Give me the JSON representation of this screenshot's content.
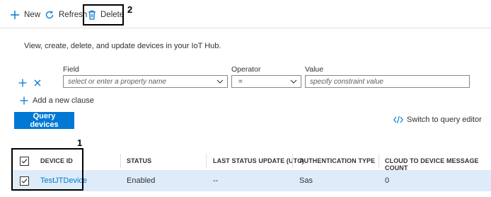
{
  "toolbar": {
    "new_label": "New",
    "refresh_label": "Refresh",
    "delete_label": "Delete",
    "annotation_delete": "2"
  },
  "description": "View, create, delete, and update devices in your IoT Hub.",
  "filter": {
    "field_label": "Field",
    "field_placeholder": "select or enter a property name",
    "operator_label": "Operator",
    "operator_value": "=",
    "value_label": "Value",
    "value_placeholder": "specify constraint value",
    "add_clause_label": "Add a new clause"
  },
  "query_button_label": "Query devices",
  "switch_editor_label": "Switch to query editor",
  "table": {
    "annotation_table": "1",
    "columns": [
      "DEVICE ID",
      "STATUS",
      "LAST STATUS UPDATE (UTC)",
      "AUTHENTICATION TYPE",
      "CLOUD TO DEVICE MESSAGE COUNT"
    ],
    "rows": [
      {
        "device_id": "TestJTDevice",
        "status": "Enabled",
        "last_update": "--",
        "auth_type": "Sas",
        "c2d_count": "0",
        "selected": true
      }
    ]
  },
  "colors": {
    "accent": "#0078d4",
    "selected_row": "#deecf9"
  }
}
